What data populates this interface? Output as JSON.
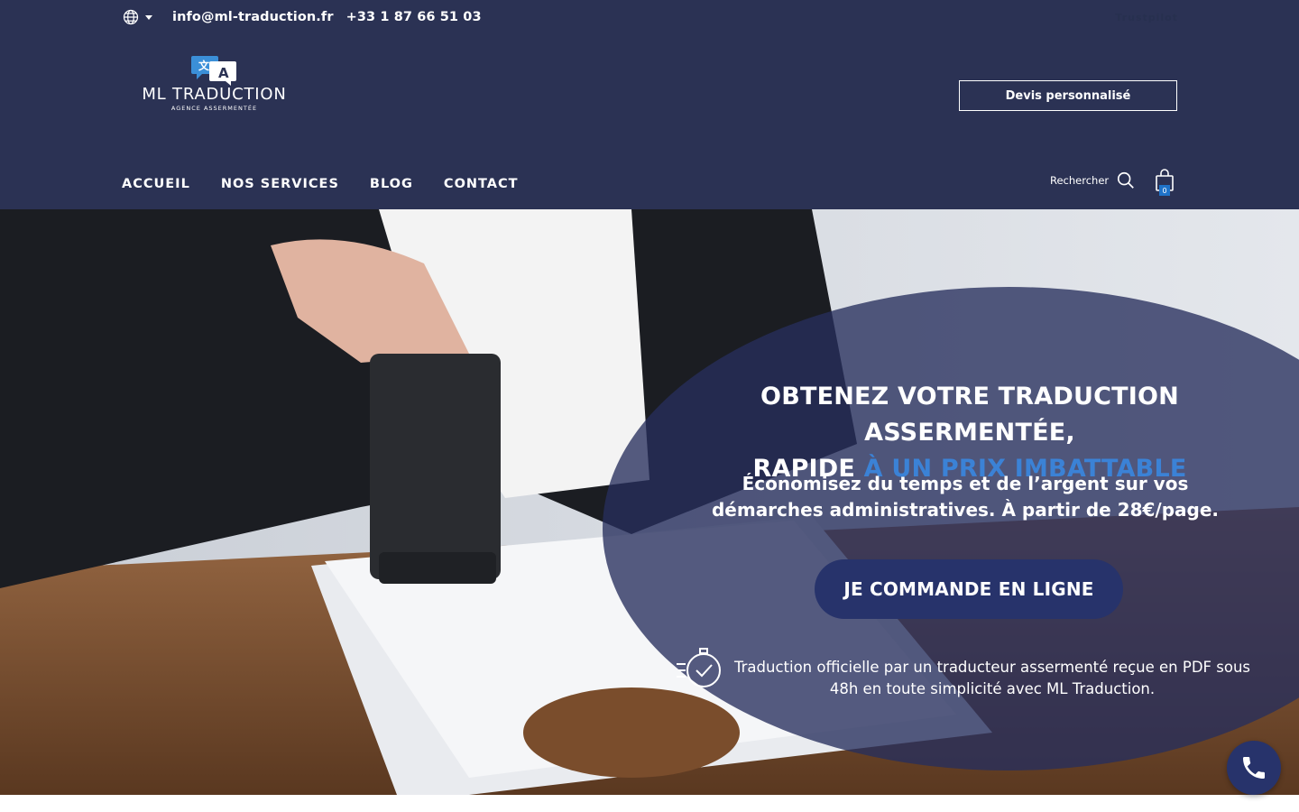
{
  "topbar": {
    "email": "info@ml-traduction.fr",
    "phone": "+33 1 87 66 51 03",
    "trustpilot": "Trustpilot"
  },
  "logo": {
    "title": "ML TRADUCTION",
    "subtitle": "AGENCE ASSERMENTÉE"
  },
  "header": {
    "quote_button": "Devis personnalisé"
  },
  "nav": {
    "items": [
      {
        "label": "ACCUEIL"
      },
      {
        "label": "NOS SERVICES"
      },
      {
        "label": "BLOG"
      },
      {
        "label": "CONTACT"
      }
    ],
    "search_label": "Rechercher",
    "cart_count": "0"
  },
  "hero": {
    "title_line1": "OBTENEZ VOTRE TRADUCTION ASSERMENTÉE,",
    "title_line2_plain": "RAPIDE ",
    "title_line2_accent": "À UN PRIX IMBATTABLE",
    "subtitle": "Économisez du temps et de l’argent sur vos démarches administratives. À partir de 28€/page.",
    "cta": "JE COMMANDE EN LIGNE",
    "note": "Traduction officielle par un traducteur assermenté reçue en PDF sous 48h en toute simplicité avec ML Traduction."
  },
  "colors": {
    "header_bg": "#2b3254",
    "accent_blue": "#3b82d6",
    "cta_bg": "#27336b",
    "overlay": "rgba(38,46,92,0.78)"
  }
}
